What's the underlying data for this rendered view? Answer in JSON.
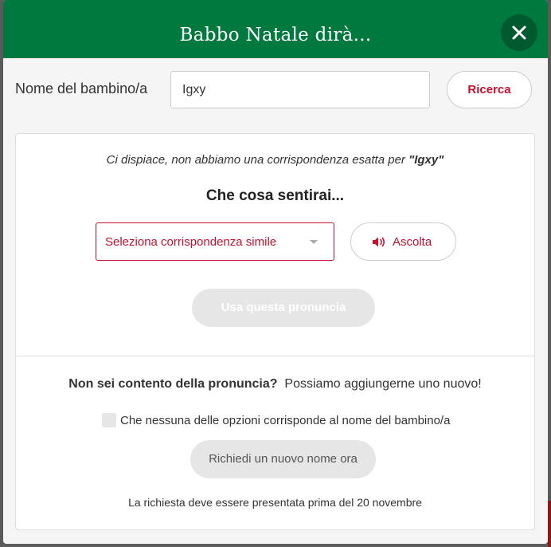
{
  "modal": {
    "title": "Babbo Natale dirà...",
    "close_icon": "close-icon"
  },
  "search": {
    "label": "Nome del bambino/a",
    "value": "Igxy",
    "button_label": "Ricerca"
  },
  "result": {
    "notice_prefix": "Ci dispiace, non abbiamo una corrispondenza esatta per ",
    "notice_name": "\"Igxy\"",
    "subtitle": "Che cosa sentirai...",
    "select_placeholder": "Seleziona corrispondenza simile",
    "listen_label": "Ascolta",
    "listen_icon": "speaker-icon",
    "use_button_label": "Usa questa pronuncia"
  },
  "request": {
    "question": "Non sei contento della pronuncia?",
    "offer": "Possiamo aggiungerne uno nuovo!",
    "checkbox_label": "Che nessuna delle opzioni corrisponde al nome del bambino/a",
    "button_label": "Richiedi un nuovo nome ora",
    "deadline": "La richiesta deve essere presentata prima del 20 novembre"
  },
  "colors": {
    "header": "#00793f",
    "accent": "#c8102e"
  }
}
